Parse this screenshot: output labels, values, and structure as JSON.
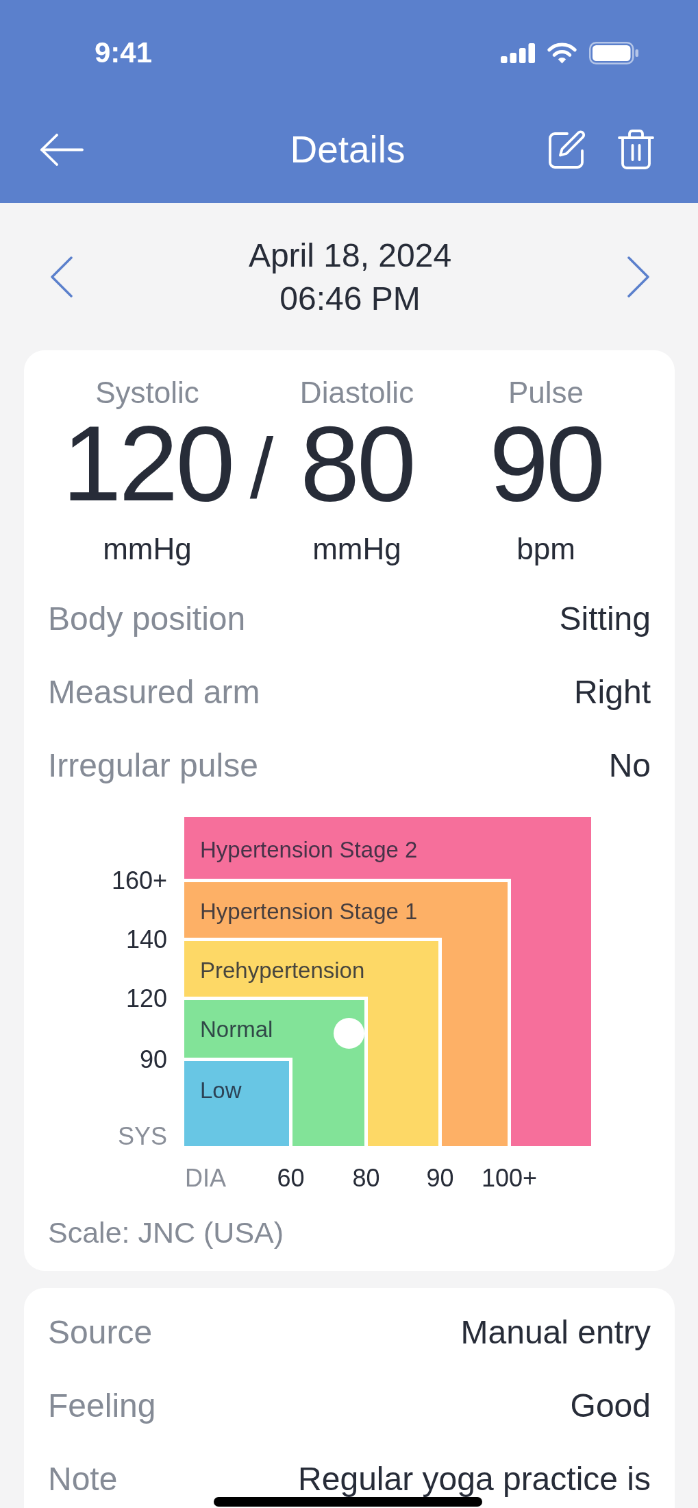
{
  "status_bar": {
    "time": "9:41"
  },
  "nav_bar": {
    "title": "Details"
  },
  "date_nav": {
    "date": "April 18, 2024",
    "time": "06:46 PM"
  },
  "reading": {
    "systolic": {
      "label": "Systolic",
      "value": "120",
      "unit": "mmHg"
    },
    "separator": "/",
    "diastolic": {
      "label": "Diastolic",
      "value": "80",
      "unit": "mmHg"
    },
    "pulse": {
      "label": "Pulse",
      "value": "90",
      "unit": "bpm"
    }
  },
  "measurement_details": [
    {
      "label": "Body position",
      "value": "Sitting"
    },
    {
      "label": "Measured arm",
      "value": "Right"
    },
    {
      "label": "Irregular pulse",
      "value": "No"
    }
  ],
  "bp_chart": {
    "zones": [
      {
        "label": "Hypertension Stage 2",
        "color": "#f66f9b",
        "selected": false
      },
      {
        "label": "Hypertension Stage 1",
        "color": "#fdb066",
        "selected": false
      },
      {
        "label": "Prehypertension",
        "color": "#fdd866",
        "selected": false
      },
      {
        "label": "Normal",
        "color": "#82e398",
        "selected": true
      },
      {
        "label": "Low",
        "color": "#68c6e4",
        "selected": false
      }
    ],
    "y_axis_label": "SYS",
    "y_ticks": [
      "160+",
      "140",
      "120",
      "90"
    ],
    "x_axis_label": "DIA",
    "x_ticks": [
      "60",
      "80",
      "90",
      "100+"
    ]
  },
  "scale": "Scale: JNC (USA)",
  "entry_details": [
    {
      "label": "Source",
      "value": "Manual entry"
    },
    {
      "label": "Feeling",
      "value": "Good"
    },
    {
      "label": "Note",
      "value": "Regular yoga practice is"
    }
  ]
}
